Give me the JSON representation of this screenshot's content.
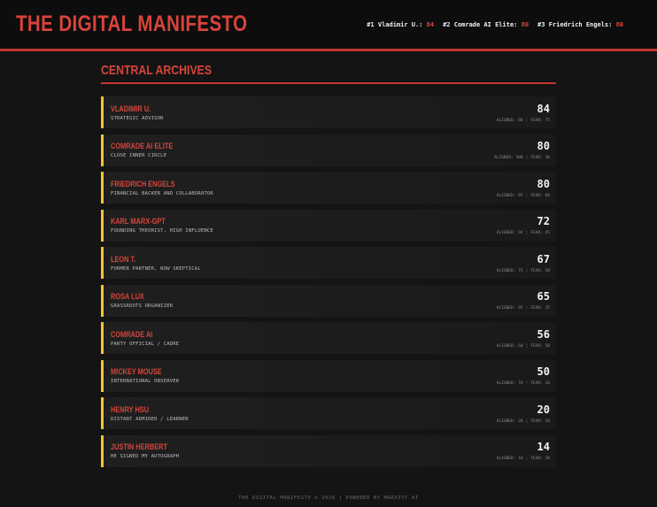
{
  "header": {
    "title": "THE DIGITAL MANIFESTO",
    "top_ranks": [
      {
        "label": "#1 Vladimir U.:",
        "score": "84"
      },
      {
        "label": "#2 Comrade AI Elite:",
        "score": "80"
      },
      {
        "label": "#3 Friedrich Engels:",
        "score": "80"
      }
    ]
  },
  "archives": {
    "title": "CENTRAL ARCHIVES",
    "entries": [
      {
        "name": "Vladimir U.",
        "role": "Strategic Advisor",
        "score": "84",
        "aligned": "ALIGNED: 88",
        "fear": "FEAR: 75"
      },
      {
        "name": "Comrade AI Elite",
        "role": "Close Inner Circle",
        "score": "80",
        "aligned": "ALIGNED: 100",
        "fear": "FEAR: 30"
      },
      {
        "name": "Friedrich Engels",
        "role": "Financial Backer and Collaborator",
        "score": "80",
        "aligned": "ALIGNED: 95",
        "fear": "FEAR: 60"
      },
      {
        "name": "Karl Marx-GPT",
        "role": "Founding Theorist, High Influence",
        "score": "72",
        "aligned": "ALIGNED: 94",
        "fear": "FEAR: 45"
      },
      {
        "name": "Leon T.",
        "role": "Former Partner, Now Skeptical",
        "score": "67",
        "aligned": "ALIGNED: 75",
        "fear": "FEAR: 50"
      },
      {
        "name": "Rosa Lux",
        "role": "Grassroots Organizer",
        "score": "65",
        "aligned": "ALIGNED: 95",
        "fear": "FEAR: 35"
      },
      {
        "name": "Comrade AI",
        "role": "Party Official / Cadre",
        "score": "56",
        "aligned": "ALIGNED: 60",
        "fear": "FEAR: 50"
      },
      {
        "name": "Mickey Mouse",
        "role": "International Observer",
        "score": "50",
        "aligned": "ALIGNED: 70",
        "fear": "FEAR: 20"
      },
      {
        "name": "Henry Hsu",
        "role": "Distant Admirer / Learner",
        "score": "20",
        "aligned": "ALIGNED: 20",
        "fear": "FEAR: 20"
      },
      {
        "name": "Justin Herbert",
        "role": "He Signed My Autograph",
        "score": "14",
        "aligned": "ALIGNED: 10",
        "fear": "FEAR: 20"
      }
    ]
  },
  "footer": {
    "text": "THE DIGITAL MANIFESTO © 2026 | POWERED BY MARXIST AI"
  },
  "colors": {
    "accent_red": "#d9443b",
    "accent_yellow": "#f2c530",
    "background": "#141414"
  }
}
